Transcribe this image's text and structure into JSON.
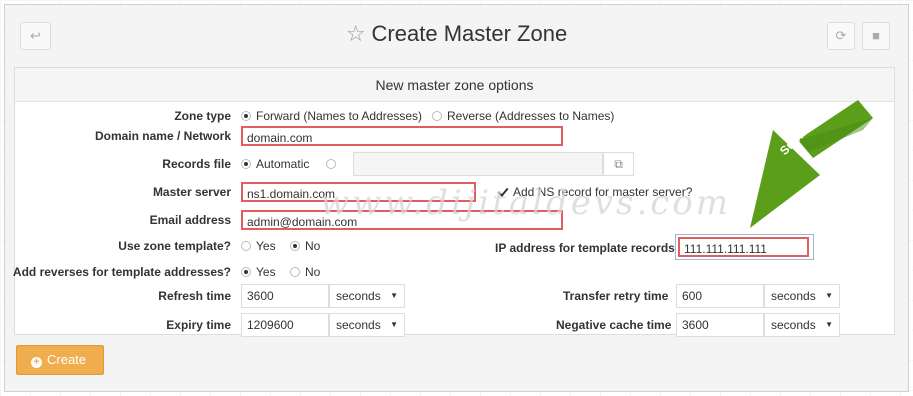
{
  "header": {
    "title": "Create Master Zone",
    "back_icon": "return-arrow-icon",
    "refresh_icon": "refresh-icon",
    "stop_icon": "stop-icon"
  },
  "panel": {
    "heading": "New master zone options"
  },
  "form": {
    "zone_type": {
      "label": "Zone type",
      "options": [
        "Forward (Names to Addresses)",
        "Reverse (Addresses to Names)"
      ],
      "selected": "Forward (Names to Addresses)"
    },
    "domain": {
      "label": "Domain name / Network",
      "value": "domain.com"
    },
    "records_file": {
      "label": "Records file",
      "option_automatic": "Automatic",
      "value": ""
    },
    "master_server": {
      "label": "Master server",
      "value": "ns1.domain.com",
      "add_ns_label": "Add NS record for master server?",
      "add_ns_checked": true
    },
    "email": {
      "label": "Email address",
      "value": "admin@domain.com"
    },
    "use_template": {
      "label": "Use zone template?",
      "yes": "Yes",
      "no": "No",
      "selected": "No"
    },
    "ip_template": {
      "label": "IP address for template records",
      "value": "111.111.111.111"
    },
    "add_reverses": {
      "label": "Add reverses for template addresses?",
      "yes": "Yes",
      "no": "No",
      "selected": "Yes"
    },
    "refresh": {
      "label": "Refresh time",
      "value": "3600",
      "unit": "seconds"
    },
    "transfer_retry": {
      "label": "Transfer retry time",
      "value": "600",
      "unit": "seconds"
    },
    "expiry": {
      "label": "Expiry time",
      "value": "1209600",
      "unit": "seconds"
    },
    "negative_cache": {
      "label": "Negative cache time",
      "value": "3600",
      "unit": "seconds"
    }
  },
  "annotation": {
    "arrow_text": "Sunucu Ip",
    "arrow_color": "#5a9e1a"
  },
  "watermark": "www.dijitaldevs.com",
  "actions": {
    "create_label": "Create"
  },
  "colors": {
    "accent": "#f0ad4e",
    "highlight_border": "#e25d60"
  }
}
